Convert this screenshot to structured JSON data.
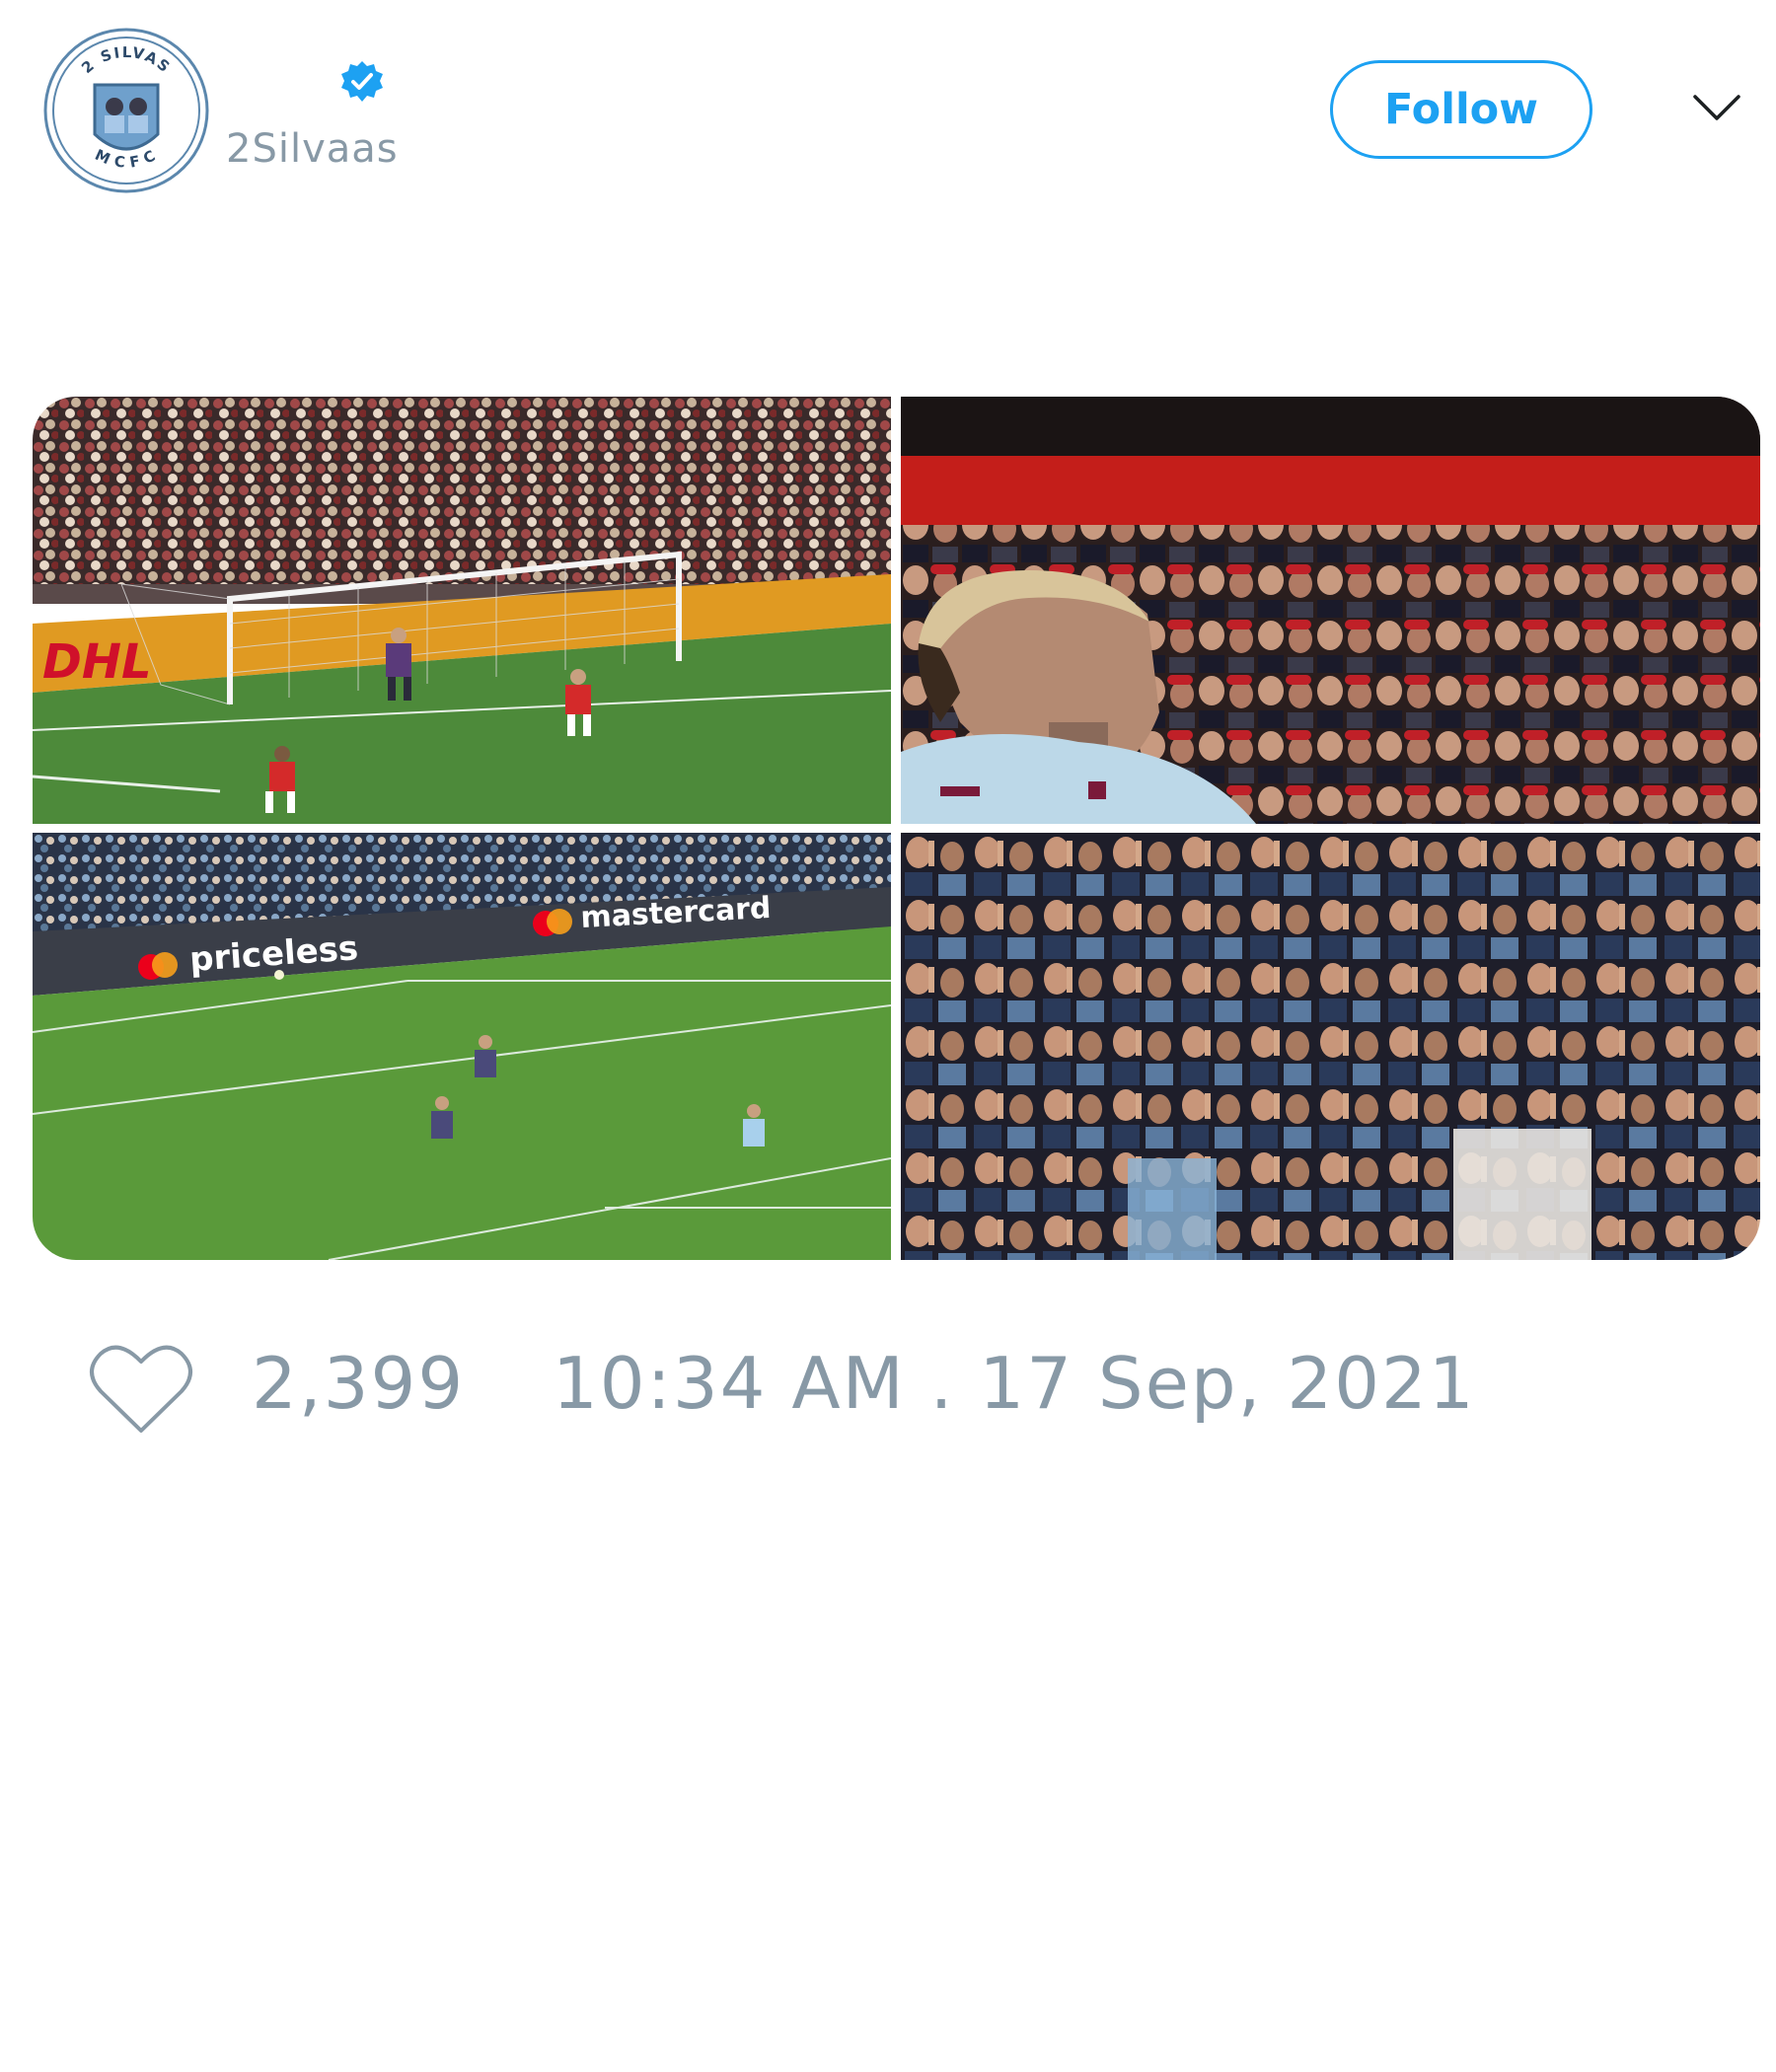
{
  "tweet": {
    "author": {
      "handle": "2Silvaas",
      "verified": true,
      "avatar": {
        "top_text": "2 SILVAS",
        "bottom_text": "MCFC",
        "ring_color": "#5b87ad",
        "fill_color": "#6fa0cc"
      }
    },
    "follow_label": "Follow",
    "menu_icon": "chevron-down-icon",
    "media": [
      {
        "scene": "goalmouth",
        "board_text": "DHL"
      },
      {
        "scene": "player-closeup"
      },
      {
        "scene": "pitch-wide",
        "board_text_left": "priceless",
        "board_text_right": "mastercard"
      },
      {
        "scene": "crowd-celebration"
      }
    ],
    "likes": "2,399",
    "timestamp": "10:34 AM . 17 Sep, 2021"
  },
  "colors": {
    "accent": "#1da1f2",
    "muted_text": "#8899a6"
  }
}
